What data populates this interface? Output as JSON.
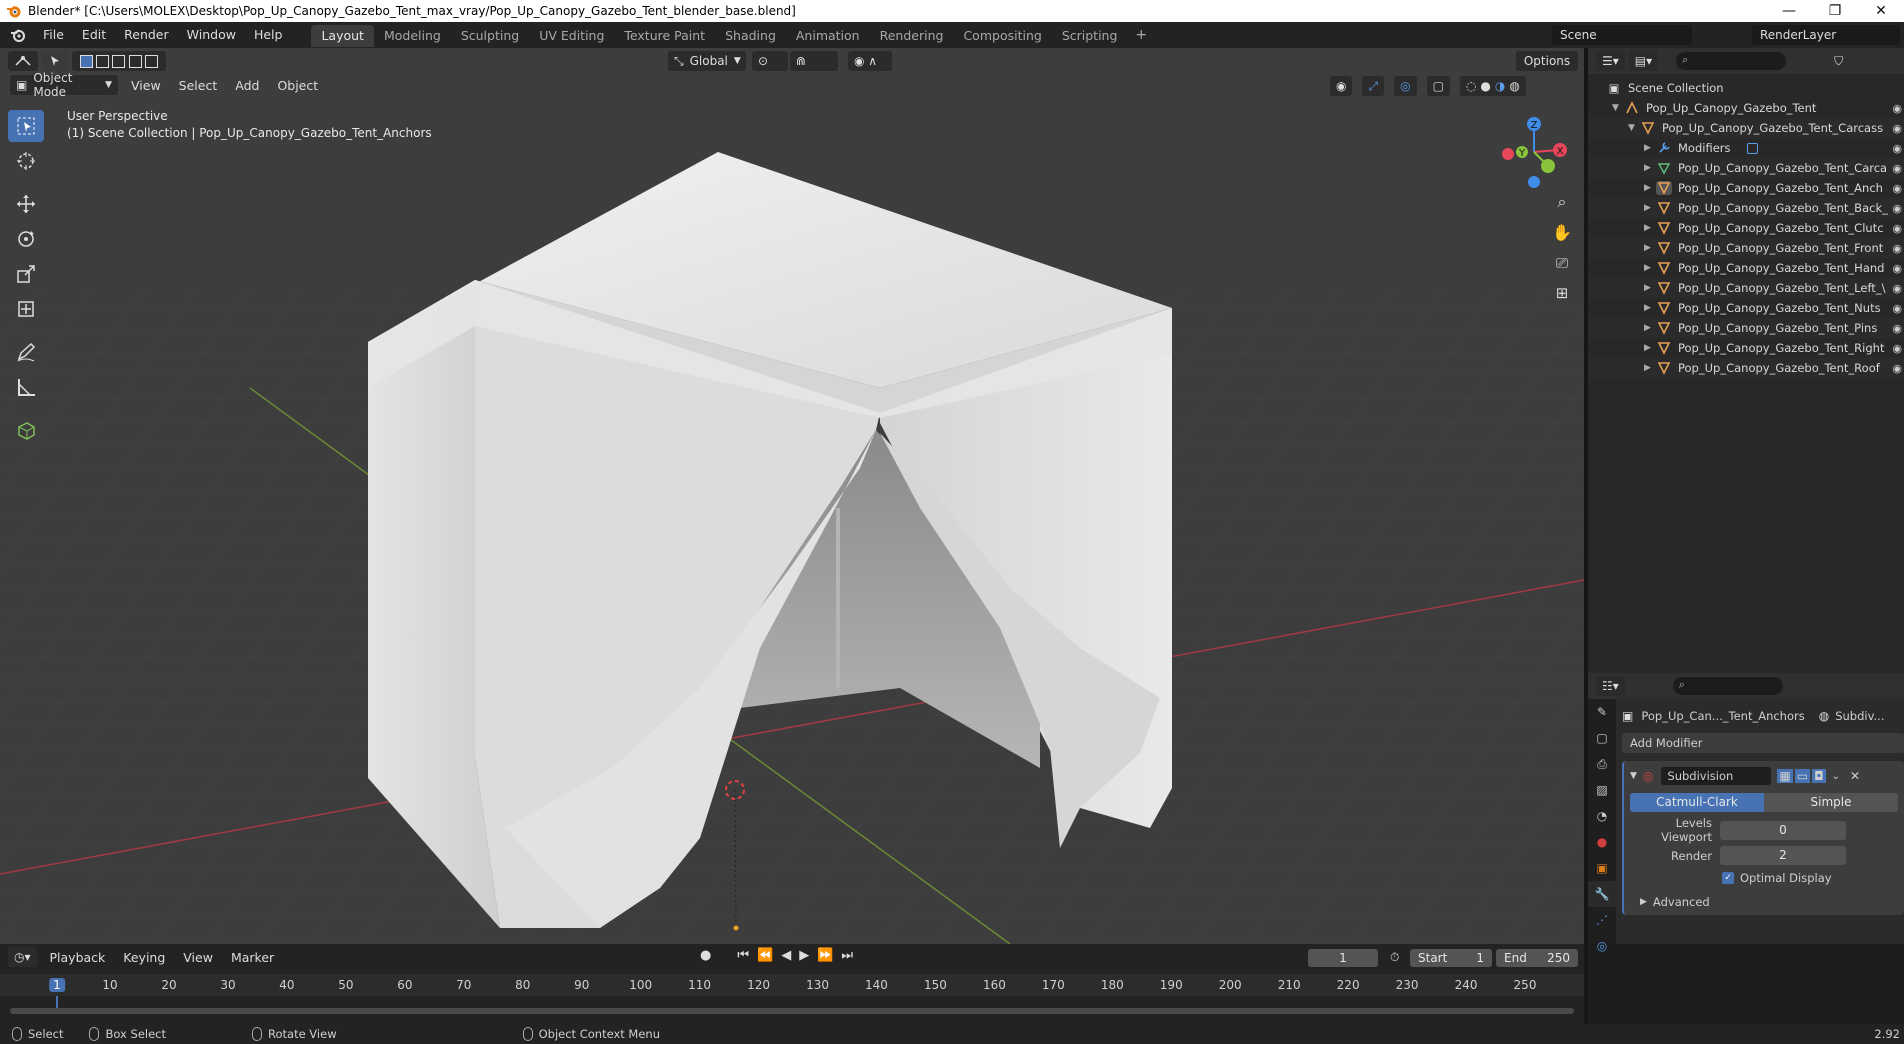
{
  "titlebar": {
    "title": "Blender* [C:\\Users\\MOLEX\\Desktop\\Pop_Up_Canopy_Gazebo_Tent_max_vray/Pop_Up_Canopy_Gazebo_Tent_blender_base.blend]",
    "minimize": "—",
    "maximize": "❐",
    "close": "✕"
  },
  "menu": {
    "items": [
      "File",
      "Edit",
      "Render",
      "Window",
      "Help"
    ],
    "workspaces": [
      "Layout",
      "Modeling",
      "Sculpting",
      "UV Editing",
      "Texture Paint",
      "Shading",
      "Animation",
      "Rendering",
      "Compositing",
      "Scripting"
    ],
    "add_tab": "+",
    "scene": "Scene",
    "render_layer": "RenderLayer"
  },
  "viewport": {
    "transform_orientation": "Global",
    "options_label": "Options",
    "mode": "Object Mode",
    "header_menus": [
      "View",
      "Select",
      "Add",
      "Object"
    ],
    "perspective_label": "User Perspective",
    "collection_label": "(1) Scene Collection | Pop_Up_Canopy_Gazebo_Tent_Anchors",
    "gizmo": {
      "x": "X",
      "y": "Y",
      "z": "Z"
    }
  },
  "outliner": {
    "root": "Scene Collection",
    "items": [
      {
        "label": "Pop_Up_Canopy_Gazebo_Tent",
        "indent": 0,
        "icon": "empty"
      },
      {
        "label": "Pop_Up_Canopy_Gazebo_Tent_Carcass",
        "indent": 1,
        "icon": "mesh"
      },
      {
        "label": "Modifiers",
        "indent": 2,
        "icon": "wrench"
      },
      {
        "label": "Pop_Up_Canopy_Gazebo_Tent_Carca",
        "indent": 2,
        "icon": "mesh-data"
      },
      {
        "label": "Pop_Up_Canopy_Gazebo_Tent_Anch",
        "indent": 2,
        "icon": "mesh"
      },
      {
        "label": "Pop_Up_Canopy_Gazebo_Tent_Back_",
        "indent": 2,
        "icon": "mesh"
      },
      {
        "label": "Pop_Up_Canopy_Gazebo_Tent_Clutc",
        "indent": 2,
        "icon": "mesh"
      },
      {
        "label": "Pop_Up_Canopy_Gazebo_Tent_Front",
        "indent": 2,
        "icon": "mesh"
      },
      {
        "label": "Pop_Up_Canopy_Gazebo_Tent_Hand",
        "indent": 2,
        "icon": "mesh"
      },
      {
        "label": "Pop_Up_Canopy_Gazebo_Tent_Left_\\",
        "indent": 2,
        "icon": "mesh"
      },
      {
        "label": "Pop_Up_Canopy_Gazebo_Tent_Nuts",
        "indent": 2,
        "icon": "mesh"
      },
      {
        "label": "Pop_Up_Canopy_Gazebo_Tent_Pins",
        "indent": 2,
        "icon": "mesh"
      },
      {
        "label": "Pop_Up_Canopy_Gazebo_Tent_Right",
        "indent": 2,
        "icon": "mesh"
      },
      {
        "label": "Pop_Up_Canopy_Gazebo_Tent_Roof",
        "indent": 2,
        "icon": "mesh"
      }
    ]
  },
  "properties": {
    "object_name": "Pop_Up_Can..._Tent_Anchors",
    "modifier_crumb": "Subdiv...",
    "add_modifier": "Add Modifier",
    "modifier_name": "Subdivision",
    "algo_catmull": "Catmull-Clark",
    "algo_simple": "Simple",
    "levels_viewport_label": "Levels Viewport",
    "levels_viewport_value": "0",
    "render_label": "Render",
    "render_value": "2",
    "optimal_display": "Optimal Display",
    "advanced": "Advanced"
  },
  "timeline": {
    "menus": [
      "Playback",
      "Keying",
      "View",
      "Marker"
    ],
    "current_frame": "1",
    "start_label": "Start",
    "start_value": "1",
    "end_label": "End",
    "end_value": "250",
    "ticks": [
      "1",
      "10",
      "20",
      "30",
      "40",
      "50",
      "60",
      "70",
      "80",
      "90",
      "100",
      "110",
      "120",
      "130",
      "140",
      "150",
      "160",
      "170",
      "180",
      "190",
      "200",
      "210",
      "220",
      "230",
      "240",
      "250"
    ]
  },
  "statusbar": {
    "select": "Select",
    "box_select": "Box Select",
    "rotate_view": "Rotate View",
    "context_menu": "Object Context Menu",
    "version": "2.92"
  },
  "colors": {
    "accent": "#4772b3",
    "x_axis": "#e8475a",
    "y_axis": "#8ac43c",
    "z_axis": "#3f8ce9"
  }
}
